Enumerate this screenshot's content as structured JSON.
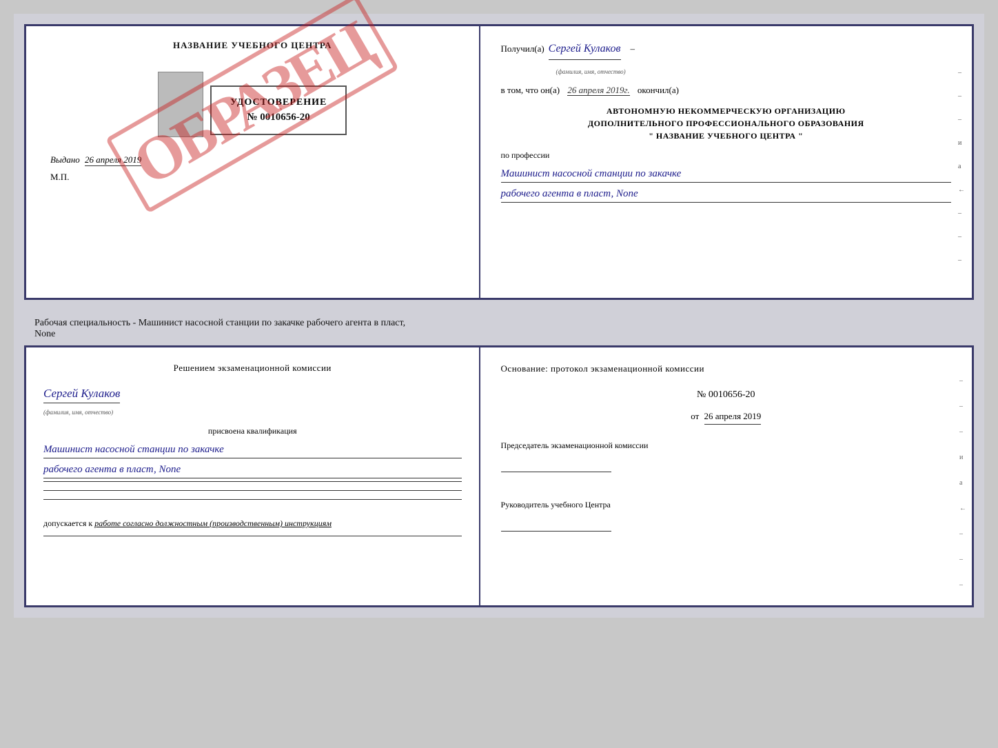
{
  "topDoc": {
    "leftPanel": {
      "centerTitle": "НАЗВАНИЕ УЧЕБНОГО ЦЕНТРА",
      "stampText": "ОБРАЗЕЦ",
      "certLabel": "УДОСТОВЕРЕНИЕ",
      "certNumber": "№ 0010656-20",
      "vydanoLabel": "Выдано",
      "vydanoDate": "26 апреля 2019",
      "mpLabel": "М.П."
    },
    "rightPanel": {
      "poluchilLabel": "Получил(а)",
      "poluchilName": "Сергей Кулаков",
      "familiyaHint": "(фамилия, имя, отчество)",
      "dash1": "–",
      "vtomLabel": "в том, что он(а)",
      "vtomDate": "26 апреля 2019г.",
      "okonchilLabel": "окончил(а)",
      "orgLine1": "АВТОНОМНУЮ НЕКОММЕРЧЕСКУЮ ОРГАНИЗАЦИЮ",
      "orgLine2": "ДОПОЛНИТЕЛЬНОГО ПРОФЕССИОНАЛЬНОГО ОБРАЗОВАНИЯ",
      "orgLine3": "\" НАЗВАНИЕ УЧЕБНОГО ЦЕНТРА \"",
      "poProf": "по профессии",
      "prof1": "Машинист насосной станции по закачке",
      "prof2": "рабочего агента в пласт, None",
      "sideLines": [
        "-",
        "-",
        "-",
        "и",
        "а",
        "←",
        "-",
        "-",
        "-"
      ]
    }
  },
  "middleText": "Рабочая специальность - Машинист насосной станции по закачке рабочего агента в пласт,\nNone",
  "bottomDoc": {
    "leftPanel": {
      "resheniemLabel": "Решением  экзаменационной  комиссии",
      "nameHand": "Сергей Кулаков",
      "familiyaHint": "(фамилия, имя, отчество)",
      "prisvoyenaLabel": "присвоена квалификация",
      "qual1": "Машинист насосной станции по закачке",
      "qual2": "рабочего агента в пласт, None",
      "lines": [
        "___________________________",
        "___________________________",
        "___________________________"
      ],
      "dopuskaetsyaLabel": "допускается к",
      "dopuskaetsyaText": "работе согласно должностным (производственным) инструкциям",
      "line2": "___________________________"
    },
    "rightPanel": {
      "osnovaniyeLabel": "Основание:  протокол экзаменационной  комиссии",
      "protocolNum": "№  0010656-20",
      "otLabel": "от",
      "otDate": "26 апреля 2019",
      "predsedatelLabel": "Председатель экзаменационной комиссии",
      "rukovoditelLabel": "Руководитель учебного Центра",
      "sideMarks": [
        "-",
        "-",
        "-",
        "и",
        "а",
        "←",
        "-",
        "-",
        "-"
      ]
    }
  }
}
